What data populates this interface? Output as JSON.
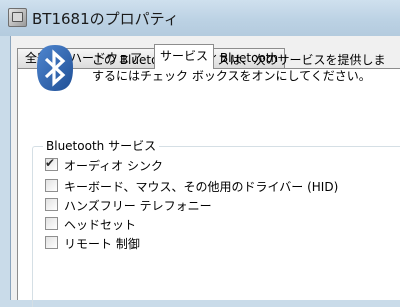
{
  "window": {
    "title": "BT1681のプロパティ"
  },
  "tabs": [
    {
      "label": "全般"
    },
    {
      "label": "ハードウェア"
    },
    {
      "label": "サービス"
    },
    {
      "label": "Bluetooth"
    }
  ],
  "active_tab": "サービス",
  "description": {
    "line1": "この  Bluetooth デバイスは、次のサービスを提供しま",
    "line2": "するにはチェック ボックスをオンにしてください。"
  },
  "services_group": {
    "label": "Bluetooth サービス",
    "items": [
      {
        "label": "オーディオ シンク",
        "checked": true
      },
      {
        "label": "キーボード、マウス、その他用のドライバー (HID)",
        "checked": false
      },
      {
        "label": "ハンズフリー テレフォニー",
        "checked": false
      },
      {
        "label": "ヘッドセット",
        "checked": false
      },
      {
        "label": "リモート 制御",
        "checked": false
      }
    ]
  },
  "icons": {
    "window_icon": "properties-window-icon",
    "bluetooth": "bluetooth-icon",
    "check": "checkmark-icon"
  },
  "colors": {
    "bluetooth_blue": "#2b62b0",
    "title_bar": "#bcd2e4"
  }
}
